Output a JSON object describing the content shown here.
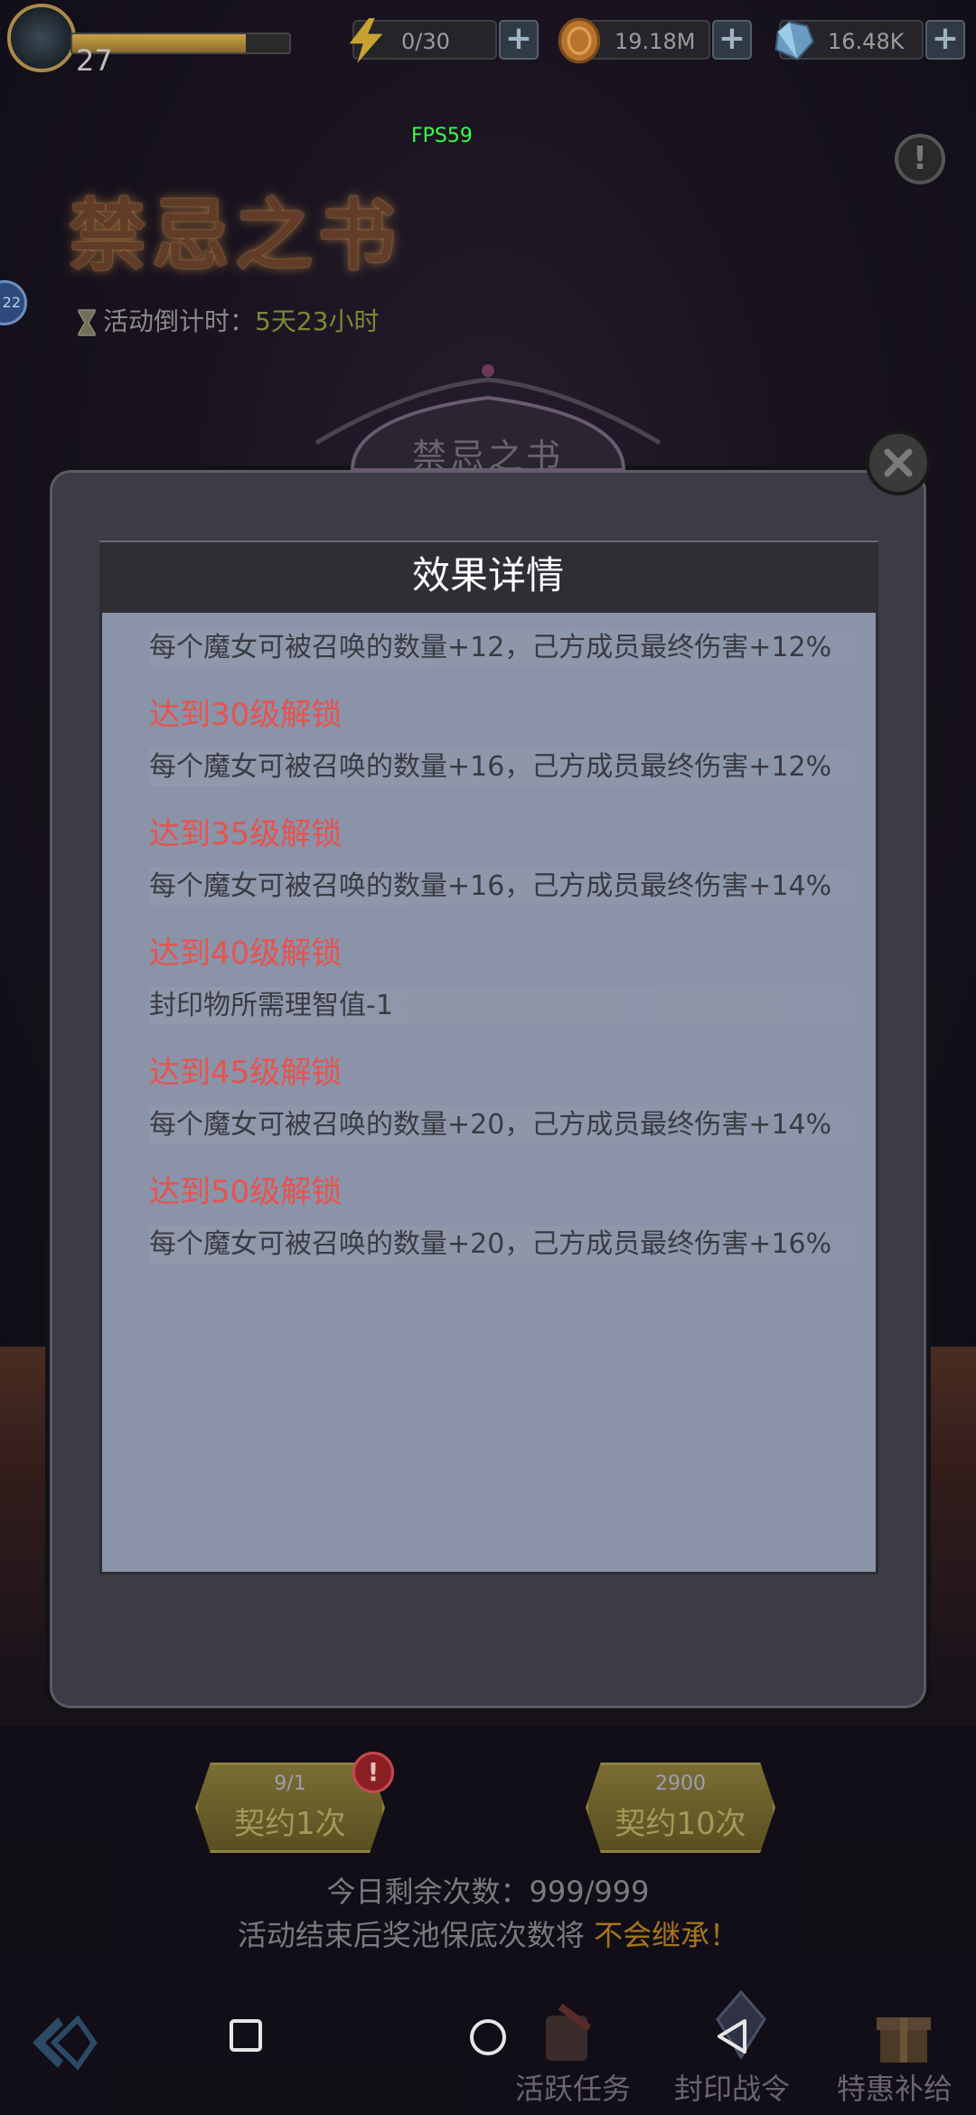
{
  "status_bar": {
    "level": "27",
    "xp_fraction": 0.8,
    "energy": "0/30",
    "gold": "19.18M",
    "gems": "16.48K"
  },
  "fps": "FPS59",
  "event": {
    "title": "禁忌之书",
    "countdown_label": "活动倒计时：",
    "countdown_value": "5天23小时"
  },
  "side_badge": "22",
  "modal": {
    "banner_title": "禁忌之书",
    "panel_title": "效果详情",
    "first_desc": "每个魔女可被召唤的数量+12，己方成员最终伤害+12%",
    "items": [
      {
        "unlock": "达到30级解锁",
        "desc": "每个魔女可被召唤的数量+16，己方成员最终伤害+12%"
      },
      {
        "unlock": "达到35级解锁",
        "desc": "每个魔女可被召唤的数量+16，己方成员最终伤害+14%"
      },
      {
        "unlock": "达到40级解锁",
        "desc": "封印物所需理智值-1"
      },
      {
        "unlock": "达到45级解锁",
        "desc": "每个魔女可被召唤的数量+20，己方成员最终伤害+14%"
      },
      {
        "unlock": "达到50级解锁",
        "desc": "每个魔女可被召唤的数量+20，己方成员最终伤害+16%"
      }
    ]
  },
  "actions": {
    "pull1": {
      "cost": "9/1",
      "label": "契约1次"
    },
    "pull10": {
      "cost": "2900",
      "label": "契约10次"
    },
    "alert": "!",
    "remaining": "今日剩余次数：999/999",
    "notice_prefix": "活动结束后奖池保底次数将",
    "notice_highlight": "不会继承！"
  },
  "nav": {
    "tasks": "活跃任务",
    "pass": "封印战令",
    "supply": "特惠补给"
  },
  "colors": {
    "unlock_red": "#e8524f",
    "panel_bg": "#8a93a7",
    "countdown_green": "#7b8a36",
    "highlight_orange": "#a8751e"
  }
}
